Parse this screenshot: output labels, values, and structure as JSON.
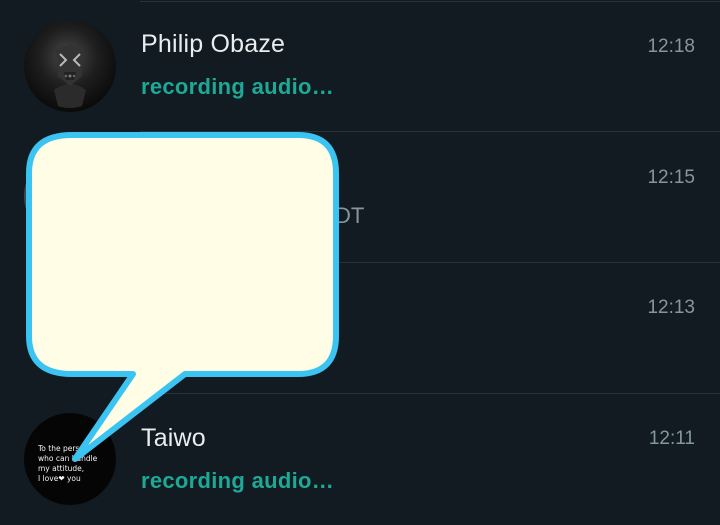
{
  "chats": [
    {
      "name": "Philip Obaze",
      "status": "recording audio…",
      "time": "12:18",
      "avatar_icon": "masked-figure-avatar-icon"
    },
    {
      "name": "",
      "preview_fragment": "DT",
      "time": "12:15",
      "avatar_icon": "partially-hidden-avatar-icon"
    },
    {
      "name": "",
      "time": "12:13"
    },
    {
      "name": "Taiwo",
      "status": "recording audio…",
      "time": "12:11",
      "avatar_quote": "To the person\nwho can handle\nmy attitude,\nI love❤ you"
    }
  ],
  "colors": {
    "background": "#111b21",
    "accent_green": "#1ea896",
    "name_text": "#e9edef",
    "muted_text": "#8696a0",
    "divider": "#26333b",
    "callout_fill": "#fffde6",
    "callout_border": "#3bc3f2"
  }
}
